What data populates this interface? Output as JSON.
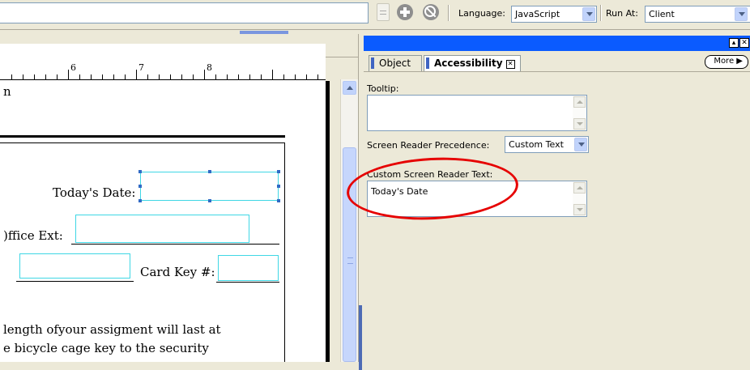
{
  "toolbar": {
    "language_label": "Language:",
    "language_value": "JavaScript",
    "run_at_label": "Run At:",
    "run_at_value": "Client"
  },
  "ruler": {
    "numbers": [
      "6",
      "7",
      "8"
    ]
  },
  "document": {
    "top_fragment": "n",
    "todays_date_label": "Today's Date:",
    "office_ext_label": ")ffice Ext:",
    "card_key_label": "Card Key #:",
    "line1": "length ofyour assigment will last at",
    "line2": "e bicycle cage key to the security"
  },
  "panel": {
    "tabs": {
      "object": "Object",
      "accessibility": "Accessibility",
      "more": "More"
    },
    "tooltip_label": "Tooltip:",
    "tooltip_value": "",
    "precedence_label": "Screen Reader Precedence:",
    "precedence_value": "Custom Text",
    "custom_text_label": "Custom Screen Reader Text:",
    "custom_text_value": "Today's Date"
  },
  "colors": {
    "panel_titlebar": "#0a5bff",
    "field_border": "#3fd7e5",
    "annotation": "#e60000"
  }
}
